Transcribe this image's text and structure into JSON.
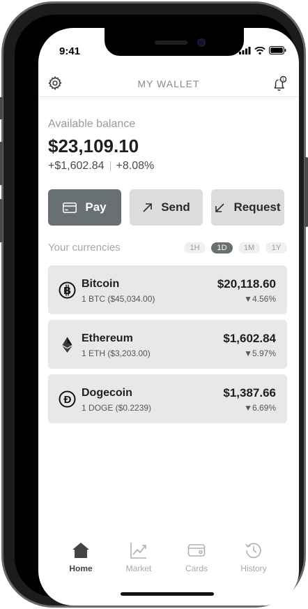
{
  "status_bar": {
    "time": "9:41"
  },
  "header": {
    "title": "MY WALLET",
    "settings_icon": "gear-icon",
    "notifications_icon": "bell-icon",
    "notification_count": "1"
  },
  "balance": {
    "label": "Available balance",
    "amount": "$23,109.10",
    "change_amount": "+$1,602.84",
    "change_percent": "+8.08%"
  },
  "actions": [
    {
      "label": "Pay",
      "icon": "card-icon"
    },
    {
      "label": "Send",
      "icon": "arrow-up-right-icon"
    },
    {
      "label": "Request",
      "icon": "arrow-down-left-icon"
    }
  ],
  "currencies": {
    "label": "Your currencies",
    "periods": [
      "1H",
      "1D",
      "1M",
      "1Y"
    ],
    "selected_period": "1D",
    "items": [
      {
        "name": "Bitcoin",
        "holding": "1 BTC ($45,034.00)",
        "value": "$20,118.60",
        "change": "▼4.56%",
        "icon": "bitcoin-icon"
      },
      {
        "name": "Ethereum",
        "holding": "1 ETH ($3,203.00)",
        "value": "$1,602.84",
        "change": "▼5.97%",
        "icon": "ethereum-icon"
      },
      {
        "name": "Dogecoin",
        "holding": "1 DOGE ($0.2239)",
        "value": "$1,387.66",
        "change": "▼6.69%",
        "icon": "dogecoin-icon"
      }
    ]
  },
  "tabs": [
    {
      "label": "Home",
      "icon": "home-icon",
      "active": true
    },
    {
      "label": "Market",
      "icon": "chart-icon",
      "active": false
    },
    {
      "label": "Cards",
      "icon": "card-icon",
      "active": false
    },
    {
      "label": "History",
      "icon": "history-icon",
      "active": false
    }
  ],
  "colors": {
    "accent": "#687072",
    "button_bg": "#dcdcdc",
    "card_bg": "#e8e8e8"
  }
}
